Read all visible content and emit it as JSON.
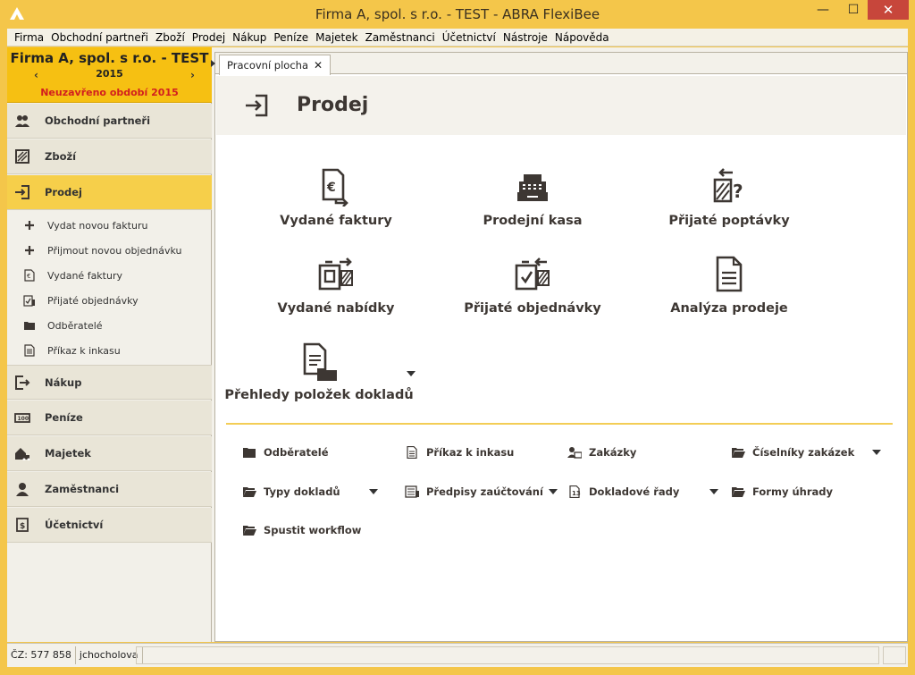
{
  "window": {
    "title": "Firma A, spol. s r.o. - TEST - ABRA FlexiBee",
    "minimize": "—",
    "maximize": "☐",
    "close": "✕"
  },
  "menu": [
    "Firma",
    "Obchodní partneři",
    "Zboží",
    "Prodej",
    "Nákup",
    "Peníze",
    "Majetek",
    "Zaměstnanci",
    "Účetnictví",
    "Nástroje",
    "Nápověda"
  ],
  "company": {
    "name": "Firma A, spol. s r.o. - TEST",
    "year": "2015",
    "prev": "‹",
    "next": "›",
    "period": "Neuzavřeno období 2015"
  },
  "sidebar": {
    "modules": [
      {
        "label": "Obchodní partneři",
        "icon": "partners-icon"
      },
      {
        "label": "Zboží",
        "icon": "goods-icon"
      },
      {
        "label": "Prodej",
        "icon": "sale-icon"
      },
      {
        "label": "Nákup",
        "icon": "purchase-icon"
      },
      {
        "label": "Peníze",
        "icon": "money-icon"
      },
      {
        "label": "Majetek",
        "icon": "property-icon"
      },
      {
        "label": "Zaměstnanci",
        "icon": "employee-icon"
      },
      {
        "label": "Účetnictví",
        "icon": "accounting-icon"
      }
    ],
    "sub_items": [
      {
        "label": "Vydat novou fakturu",
        "icon": "plus-icon"
      },
      {
        "label": "Přijmout novou objednávku",
        "icon": "plus-icon"
      },
      {
        "label": "Vydané faktury",
        "icon": "invoice-icon"
      },
      {
        "label": "Přijaté objednávky",
        "icon": "order-icon"
      },
      {
        "label": "Odběratelé",
        "icon": "folder-icon"
      },
      {
        "label": "Příkaz k inkasu",
        "icon": "document-icon"
      }
    ]
  },
  "tab": {
    "label": "Pracovní plocha",
    "close": "✕"
  },
  "page": {
    "title": "Prodej"
  },
  "tiles": [
    {
      "label": "Vydané faktury"
    },
    {
      "label": "Prodejní kasa"
    },
    {
      "label": "Přijaté poptávky"
    },
    {
      "label": "Vydané nabídky"
    },
    {
      "label": "Přijaté objednávky"
    },
    {
      "label": "Analýza prodeje"
    },
    {
      "label": "Přehledy položek dokladů"
    }
  ],
  "links": [
    {
      "label": "Odběratelé"
    },
    {
      "label": "Příkaz k inkasu"
    },
    {
      "label": "Zakázky"
    },
    {
      "label": "Číselníky zakázek"
    },
    {
      "label": "Typy dokladů"
    },
    {
      "label": "Předpisy zaúčtování"
    },
    {
      "label": "Dokladové řady"
    },
    {
      "label": "Formy úhrady"
    },
    {
      "label": "Spustit workflow"
    }
  ],
  "status": {
    "cz": "ČZ: 577 858",
    "user": "jchocholova"
  },
  "colors": {
    "accent": "#f6c012",
    "active_nav": "#f6cf4a",
    "period_text": "#d21f1f",
    "icon": "#3d3733"
  }
}
